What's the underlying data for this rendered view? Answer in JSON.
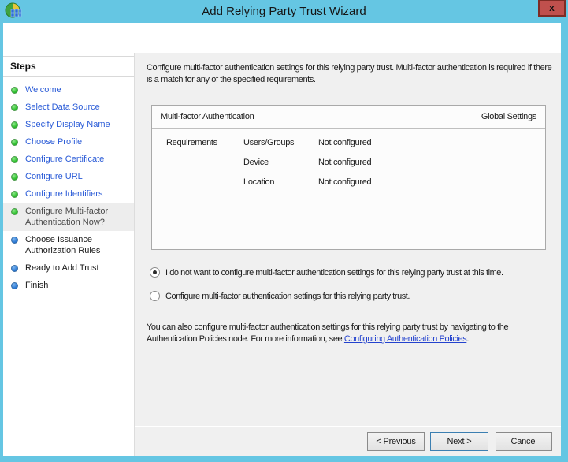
{
  "window": {
    "title": "Add Relying Party Trust Wizard",
    "close_label": "x"
  },
  "colors": {
    "titlebar": "#65C6E3",
    "close_button": "#C0504D",
    "close_button_border": "#7E2B25",
    "completed_dot": "#2FBF2F",
    "upcoming_dot": "#2E7CD6",
    "sidebar_link": "#2A5BD7",
    "footer_link": "#2342CE",
    "current_step_highlight": "#EDEDED",
    "content_background": "#F0F0F0",
    "next_button_border": "#3C7FB1"
  },
  "steps_panel": {
    "header": "Steps",
    "items": [
      {
        "label": "Welcome",
        "state": "completed"
      },
      {
        "label": "Select Data Source",
        "state": "completed"
      },
      {
        "label": "Specify Display Name",
        "state": "completed"
      },
      {
        "label": "Choose Profile",
        "state": "completed"
      },
      {
        "label": "Configure Certificate",
        "state": "completed"
      },
      {
        "label": "Configure URL",
        "state": "completed"
      },
      {
        "label": "Configure Identifiers",
        "state": "completed"
      },
      {
        "label": "Configure Multi-factor Authentication Now?",
        "state": "current"
      },
      {
        "label": "Choose Issuance Authorization Rules",
        "state": "upcoming"
      },
      {
        "label": "Ready to Add Trust",
        "state": "upcoming"
      },
      {
        "label": "Finish",
        "state": "upcoming"
      }
    ]
  },
  "main": {
    "intro": "Configure multi-factor authentication settings for this relying party trust. Multi-factor authentication is required if there is a match for any of the specified requirements.",
    "table": {
      "header_left": "Multi-factor Authentication",
      "header_right": "Global Settings",
      "rows": [
        {
          "group": "Requirements",
          "item": "Users/Groups",
          "value": "Not configured"
        },
        {
          "group": "",
          "item": "Device",
          "value": "Not configured"
        },
        {
          "group": "",
          "item": "Location",
          "value": "Not configured"
        }
      ]
    },
    "radios": [
      {
        "label": "I do not want to configure multi-factor authentication settings for this relying party trust at this time.",
        "selected": true
      },
      {
        "label": "Configure multi-factor authentication settings for this relying party trust.",
        "selected": false
      }
    ],
    "footer_text_before": "You can also configure multi-factor authentication settings for this relying party trust by navigating to the Authentication Policies node. For more information, see ",
    "footer_link": "Configuring Authentication Policies",
    "footer_text_after": "."
  },
  "buttons": {
    "previous": "< Previous",
    "next": "Next >",
    "cancel": "Cancel"
  }
}
